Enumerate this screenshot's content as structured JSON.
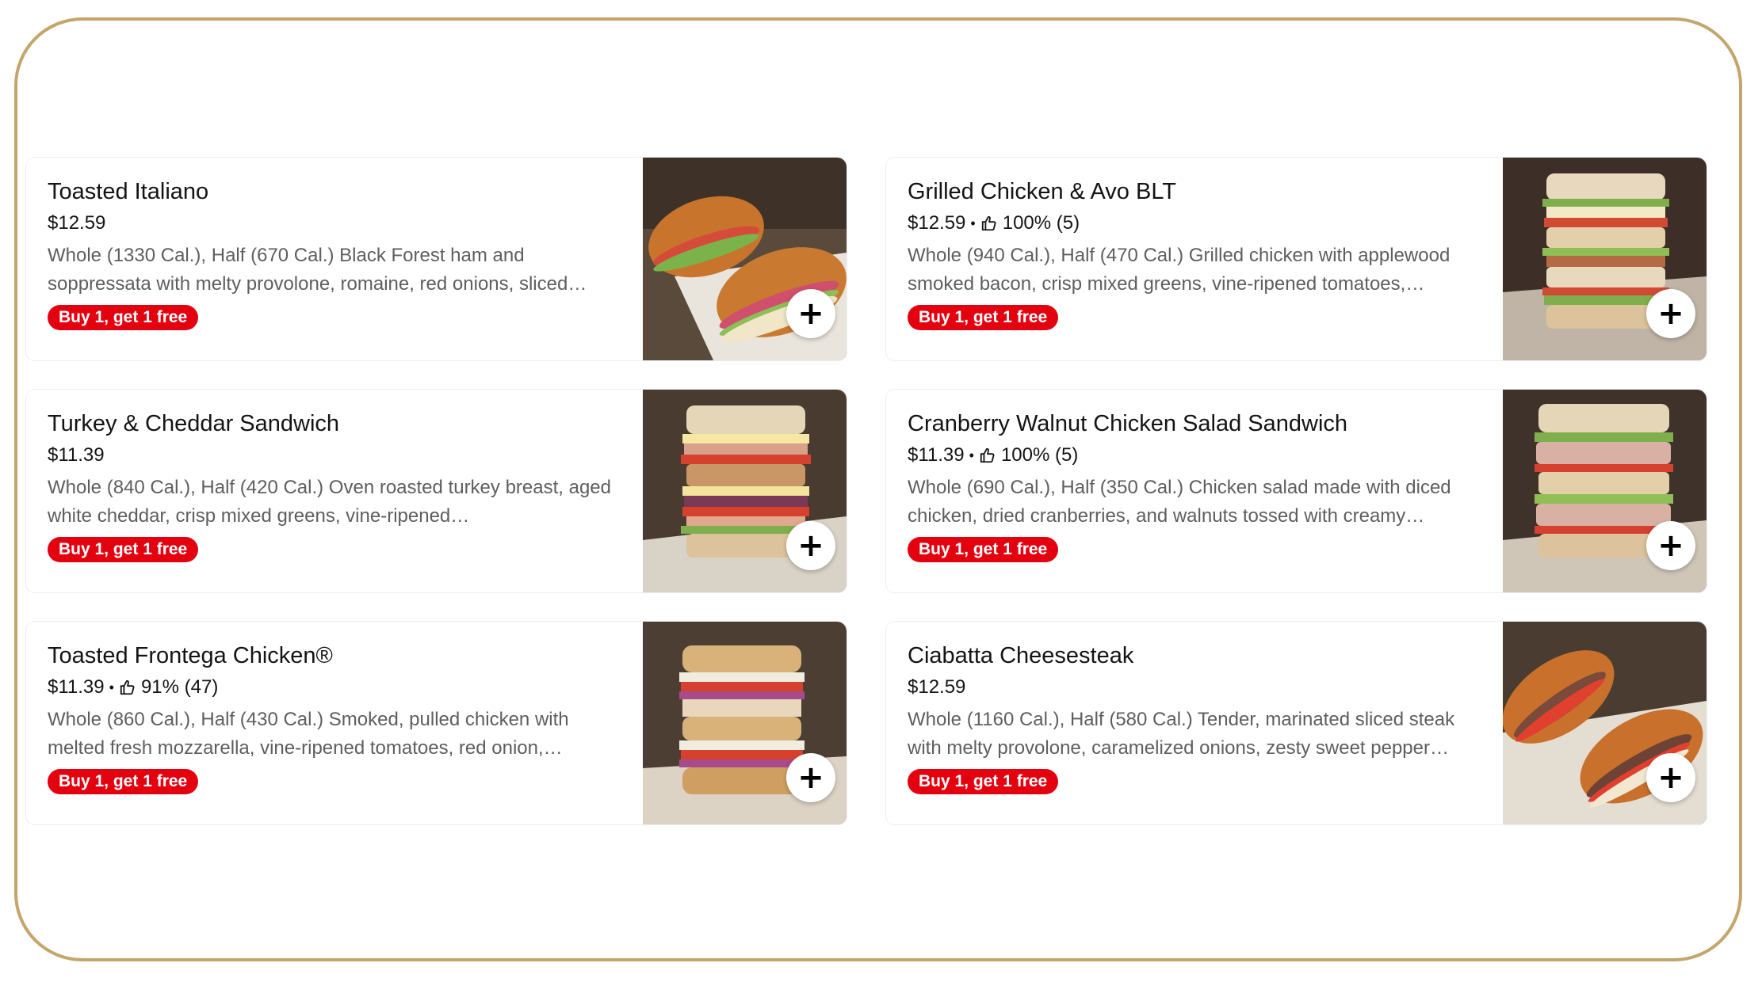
{
  "menu": {
    "items": [
      {
        "name": "Toasted Italiano",
        "price": "$12.59",
        "rating": "",
        "description": "Whole (1330 Cal.), Half (670 Cal.) Black Forest ham and soppressata with melty provolone, romaine, red onions, sliced…",
        "promo": "Buy 1, get 1 free",
        "add_label": "+",
        "image": "toasted-italiano-sandwich-photo"
      },
      {
        "name": "Grilled Chicken & Avo BLT",
        "price": "$12.59",
        "rating": "100% (5)",
        "description": "Whole (940 Cal.), Half (470 Cal.) Grilled chicken with applewood smoked bacon, crisp mixed greens, vine-ripened tomatoes,…",
        "promo": "Buy 1, get 1 free",
        "add_label": "+",
        "image": "grilled-chicken-avo-blt-photo"
      },
      {
        "name": "Turkey & Cheddar Sandwich",
        "price": "$11.39",
        "rating": "",
        "description": "Whole (840 Cal.), Half (420 Cal.) Oven roasted turkey breast, aged white cheddar, crisp mixed greens, vine-ripened…",
        "promo": "Buy 1, get 1 free",
        "add_label": "+",
        "image": "turkey-cheddar-sandwich-photo"
      },
      {
        "name": "Cranberry Walnut Chicken Salad Sandwich",
        "price": "$11.39",
        "rating": "100% (5)",
        "description": "Whole (690 Cal.), Half (350 Cal.) Chicken salad made with diced chicken, dried cranberries, and walnuts tossed with creamy…",
        "promo": "Buy 1, get 1 free",
        "add_label": "+",
        "image": "cranberry-walnut-chicken-salad-photo"
      },
      {
        "name": "Toasted Frontega Chicken®",
        "price": "$11.39",
        "rating": "91% (47)",
        "description": "Whole (860 Cal.), Half (430 Cal.) Smoked, pulled chicken with melted fresh mozzarella, vine-ripened tomatoes, red onion,…",
        "promo": "Buy 1, get 1 free",
        "add_label": "+",
        "image": "toasted-frontega-chicken-photo"
      },
      {
        "name": "Ciabatta Cheesesteak",
        "price": "$12.59",
        "rating": "",
        "description": "Whole (1160 Cal.), Half (580 Cal.) Tender, marinated sliced steak with melty provolone, caramelized onions, zesty sweet pepper…",
        "promo": "Buy 1, get 1 free",
        "add_label": "+",
        "image": "ciabatta-cheesesteak-photo"
      }
    ],
    "rating_separator": "•"
  },
  "colors": {
    "frame_border": "#c4a56b",
    "promo_bg": "#e3000f",
    "promo_text": "#ffffff",
    "title_text": "#141414",
    "description_text": "#5e5e5e"
  },
  "icons": {
    "rating": "thumbs-up-icon",
    "add": "plus-icon"
  }
}
